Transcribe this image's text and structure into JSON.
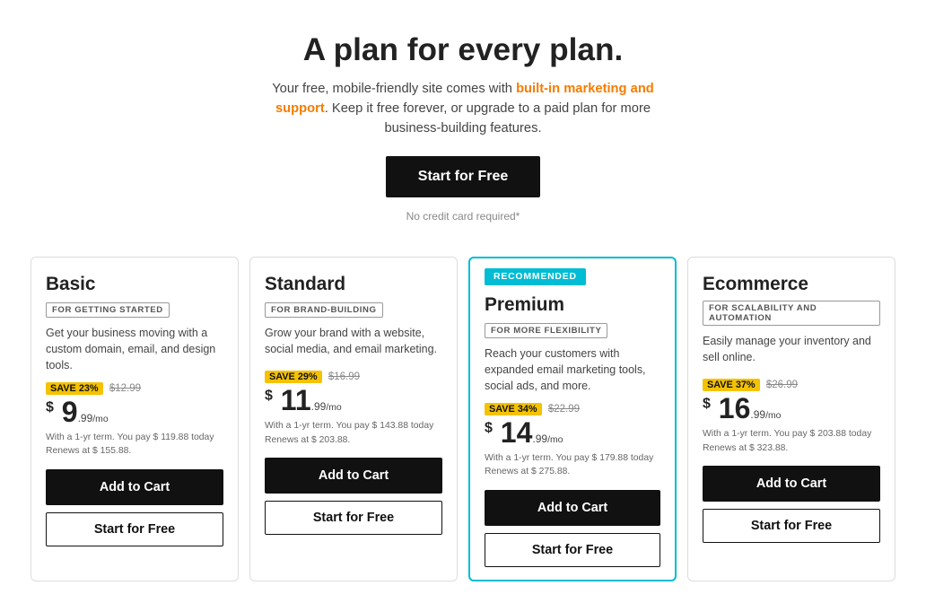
{
  "hero": {
    "title": "A plan for every plan.",
    "subtitle_plain": "Your free, mobile-friendly site comes with built-in marketing and support. Keep it free forever, or upgrade to a paid plan for more business-building features.",
    "subtitle_highlight": "built-in marketing and support",
    "cta_label": "Start for Free",
    "no_cc_text": "No credit card required*"
  },
  "plans": [
    {
      "name": "Basic",
      "tag": "FOR GETTING STARTED",
      "desc": "Get your business moving with a custom domain, email, and design tools.",
      "save_pct": "SAVE 23%",
      "original_price": "$12.99",
      "price_dollars": "9",
      "price_cents": "99",
      "recommended": false,
      "term_line1": "With a 1-yr term. You pay $ 119.88 today",
      "term_line2": "Renews at $ 155.88.",
      "add_cart_label": "Add to Cart",
      "start_free_label": "Start for Free"
    },
    {
      "name": "Standard",
      "tag": "FOR BRAND-BUILDING",
      "desc": "Grow your brand with a website, social media, and email marketing.",
      "save_pct": "SAVE 29%",
      "original_price": "$16.99",
      "price_dollars": "11",
      "price_cents": "99",
      "recommended": false,
      "term_line1": "With a 1-yr term. You pay $ 143.88 today",
      "term_line2": "Renews at $ 203.88.",
      "add_cart_label": "Add to Cart",
      "start_free_label": "Start for Free"
    },
    {
      "name": "Premium",
      "tag": "FOR MORE FLEXIBILITY",
      "desc": "Reach your customers with expanded email marketing tools, social ads, and more.",
      "save_pct": "SAVE 34%",
      "original_price": "$22.99",
      "price_dollars": "14",
      "price_cents": "99",
      "recommended": true,
      "recommended_label": "RECOMMENDED",
      "term_line1": "With a 1-yr term. You pay $ 179.88 today",
      "term_line2": "Renews at $ 275.88.",
      "add_cart_label": "Add to Cart",
      "start_free_label": "Start for Free"
    },
    {
      "name": "Ecommerce",
      "tag": "FOR SCALABILITY AND AUTOMATION",
      "desc": "Easily manage your inventory and sell online.",
      "save_pct": "SAVE 37%",
      "original_price": "$26.99",
      "price_dollars": "16",
      "price_cents": "99",
      "recommended": false,
      "term_line1": "With a 1-yr term. You pay $ 203.88 today",
      "term_line2": "Renews at $ 323.88.",
      "add_cart_label": "Add to Cart",
      "start_free_label": "Start for Free"
    }
  ]
}
